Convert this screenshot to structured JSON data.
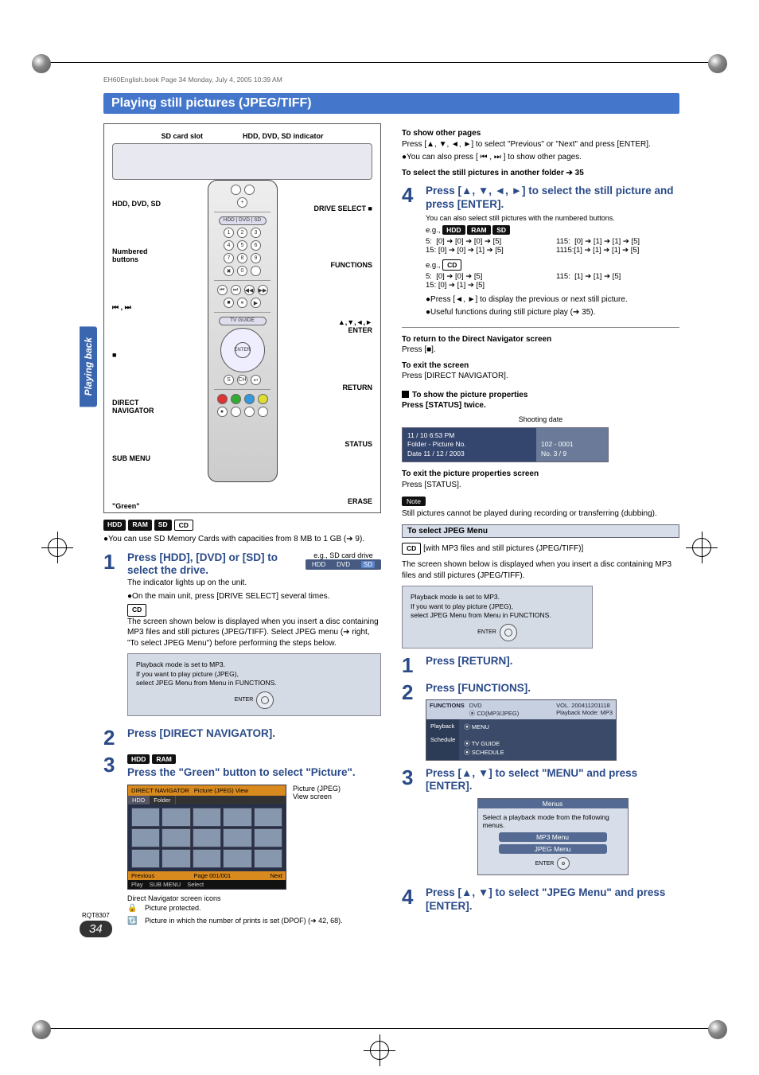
{
  "header_watermark": "EH60English.book  Page 34  Monday, July 4, 2005  10:39 AM",
  "sidebar_tab": "Playing back",
  "title": "Playing still pictures (JPEG/TIFF)",
  "remote": {
    "top_left": "SD card slot",
    "top_right": "HDD, DVD, SD indicator",
    "left": [
      "HDD, DVD, SD",
      "Numbered buttons",
      "⏮ , ⏭",
      "■",
      "DIRECT NAVIGATOR",
      "SUB MENU",
      "\"Green\""
    ],
    "right": [
      "DRIVE SELECT ■",
      "FUNCTIONS",
      "▲,▼,◄,► ENTER",
      "RETURN",
      "STATUS",
      "ERASE"
    ],
    "drive_strip": [
      "HDD",
      "DVD",
      "SD"
    ],
    "nav_center": "ENTER"
  },
  "badges_primary": [
    "HDD",
    "RAM",
    "SD",
    "CD"
  ],
  "body_intro": "●You can use SD Memory Cards with capacities from 8 MB to 1 GB (➔ 9).",
  "step1": {
    "title": "Press [HDD], [DVD] or [SD] to select the drive.",
    "aside": "e.g., SD card drive",
    "lines": [
      "The indicator lights up on the unit.",
      "●On the main unit, press [DRIVE SELECT] several times."
    ],
    "cd_badge": "CD",
    "cd_text": "The screen shown below is displayed when you insert a disc containing MP3 files and still pictures (JPEG/TIFF). Select JPEG menu (➔ right, \"To select JPEG Menu\") before performing the steps below.",
    "panel": [
      "Playback mode is set to MP3.",
      "If you want to play picture (JPEG),",
      "select JPEG Menu from Menu in FUNCTIONS."
    ],
    "panel_enter": "ENTER"
  },
  "step2_title": "Press [DIRECT NAVIGATOR].",
  "step3": {
    "badges": [
      "HDD",
      "RAM"
    ],
    "title": "Press the \"Green\" button to select \"Picture\".",
    "caption": "Picture (JPEG) View screen",
    "shot": {
      "hdr": [
        "DIRECT NAVIGATOR",
        "Picture (JPEG) View"
      ],
      "tabs": [
        "HDD",
        "Folder"
      ],
      "ftr": [
        "Previous",
        "Page 001/001",
        "Next"
      ],
      "ftr2": [
        "Play",
        "SUB MENU",
        "Select"
      ]
    },
    "legend_title": "Direct Navigator screen icons",
    "legend": [
      "Picture protected.",
      "Picture in which the number of prints is set (DPOF) (➔ 42, 68)."
    ]
  },
  "right_top": {
    "h1": "To show other pages",
    "p1": "Press [▲, ▼, ◄, ►] to select \"Previous\" or \"Next\" and press [ENTER].",
    "p2": "●You can also press [ ⏮ , ⏭ ] to show other pages.",
    "h2": "To select the still pictures in another folder ➔ 35"
  },
  "step4": {
    "title": "Press [▲, ▼, ◄, ►] to select the still picture and press [ENTER].",
    "sub": "You can also select still pictures with the numbered buttons.",
    "eg1_badges": [
      "HDD",
      "RAM",
      "SD"
    ],
    "eg1": [
      [
        "5:",
        "[0] ➔ [0] ➔ [0] ➔ [5]",
        "115:",
        "[0] ➔ [1] ➔ [1] ➔ [5]"
      ],
      [
        "15:",
        "[0] ➔ [0] ➔ [1] ➔ [5]",
        "1115:",
        "[1] ➔ [1] ➔ [1] ➔ [5]"
      ]
    ],
    "eg2_badge": "CD",
    "eg2": [
      [
        "5:",
        "[0] ➔ [0] ➔ [5]",
        "115:",
        "[1] ➔ [1] ➔ [5]"
      ],
      [
        "15:",
        "[0] ➔ [1] ➔ [5]",
        "",
        ""
      ]
    ],
    "bullets": [
      "●Press [◄, ►] to display the previous or next still picture.",
      "●Useful functions during still picture play (➔ 35)."
    ]
  },
  "return_block": {
    "h": "To return to the Direct Navigator screen",
    "p": "Press [■].",
    "h2": "To exit the screen",
    "p2": "Press [DIRECT NAVIGATOR]."
  },
  "props": {
    "h": "To show the picture properties",
    "sub": "Press [STATUS] twice.",
    "shoot": "Shooting date",
    "left": [
      "11 / 10  6:53 PM",
      "Folder - Picture No.",
      "Date    11 / 12 / 2003"
    ],
    "right": [
      "102 - 0001",
      "No.   3 /   9"
    ],
    "exit_h": "To exit the picture properties screen",
    "exit_p": "Press [STATUS]."
  },
  "note": {
    "label": "Note",
    "text": "Still pictures cannot be played during recording or transferring (dubbing)."
  },
  "jpeg_menu": {
    "bar": "To select JPEG Menu",
    "cd_badge": "CD",
    "cd_text": "[with MP3 files and still pictures (JPEG/TIFF)]",
    "intro": "The screen shown below is displayed when you insert a disc containing MP3 files and still pictures (JPEG/TIFF).",
    "panel": [
      "Playback mode is set to MP3.",
      "If you want to play picture (JPEG),",
      "select JPEG Menu from Menu in FUNCTIONS."
    ],
    "panel_enter": "ENTER",
    "s1": "Press [RETURN].",
    "s2": "Press [FUNCTIONS].",
    "func_shot": {
      "top_left": "FUNCTIONS",
      "top_mid": "DVD\n⦿ CD(MP3/JPEG)",
      "top_right": "VOL. 200411201118\nPlayback Mode: MP3",
      "side": [
        "Playback",
        "Schedule"
      ],
      "main": [
        "⦿ MENU",
        "⦿ TV GUIDE",
        "⦿ SCHEDULE"
      ]
    },
    "s3": "Press [▲, ▼] to select \"MENU\" and press [ENTER].",
    "menus": {
      "hd": "Menus",
      "txt": "Select a playback mode from the following menus.",
      "opts": [
        "MP3 Menu",
        "JPEG Menu"
      ],
      "enter": "ENTER"
    },
    "s4": "Press [▲, ▼] to select \"JPEG Menu\" and press [ENTER]."
  },
  "footer": {
    "rq": "RQT8307",
    "page": "34"
  }
}
